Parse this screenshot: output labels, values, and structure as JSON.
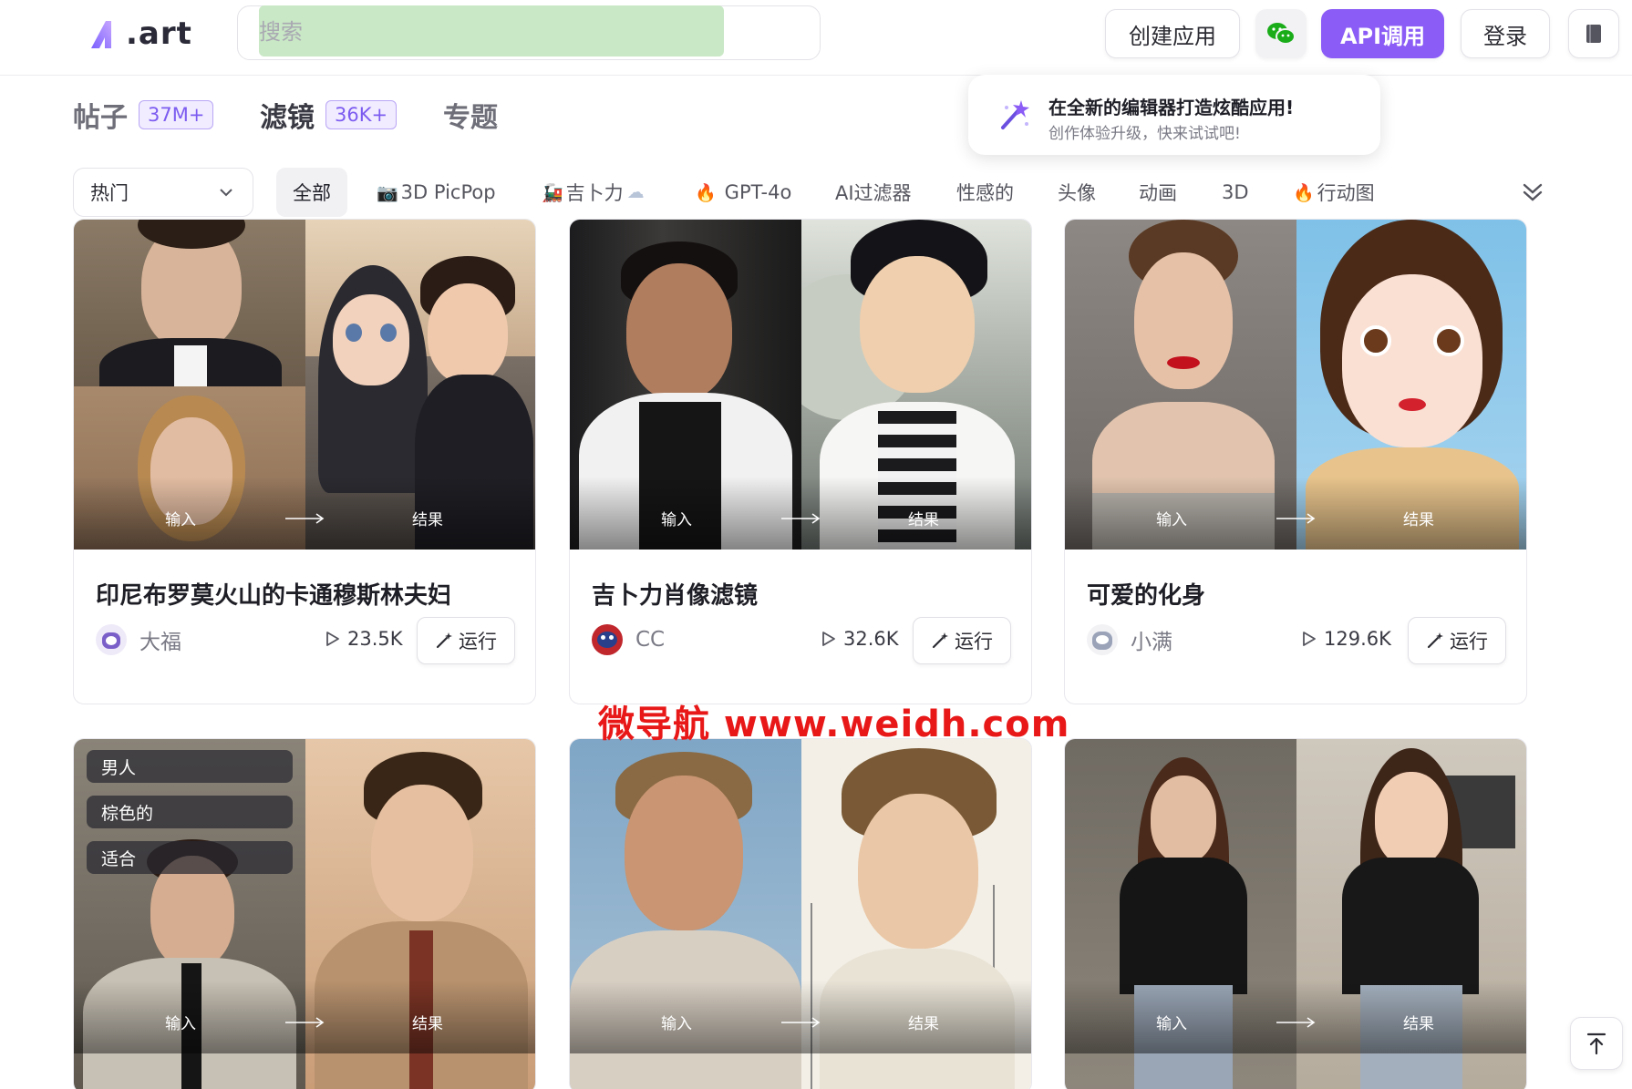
{
  "header": {
    "logo_text": ".art",
    "search": {
      "placeholder": "搜索",
      "value": ""
    },
    "buttons": {
      "create": "创建应用",
      "api": "API调用",
      "login": "登录"
    }
  },
  "promo": {
    "title": "在全新的编辑器打造炫酷应用!",
    "subtitle": "创作体验升级，快来试试吧!"
  },
  "content_tabs": [
    {
      "label": "帖子",
      "count": "37M+"
    },
    {
      "label": "滤镜",
      "count": "36K+"
    },
    {
      "label": "专题"
    }
  ],
  "filter_bar": {
    "sort_selected": "热门",
    "categories": [
      {
        "label": "全部",
        "active": true
      },
      {
        "label": "3D PicPop",
        "emoji": "📷"
      },
      {
        "label": "吉卜力",
        "emoji": "🚂",
        "suffix": "☁"
      },
      {
        "label": "GPT-4o",
        "emoji": "🔥"
      },
      {
        "label": "AI过滤器"
      },
      {
        "label": "性感的"
      },
      {
        "label": "头像"
      },
      {
        "label": "动画"
      },
      {
        "label": "3D"
      },
      {
        "label": "行动图",
        "emoji": "🔥"
      }
    ]
  },
  "cards": [
    {
      "title": "印尼布罗莫火山的卡通穆斯林夫妇",
      "author": "大福",
      "views": "23.5K",
      "run": "运行",
      "input_label": "输入",
      "output_label": "结果"
    },
    {
      "title": "吉卜力肖像滤镜",
      "author": "CC",
      "views": "32.6K",
      "run": "运行",
      "input_label": "输入",
      "output_label": "结果"
    },
    {
      "title": "可爱的化身",
      "author": "小满",
      "views": "129.6K",
      "run": "运行",
      "input_label": "输入",
      "output_label": "结果"
    },
    {
      "tags": [
        "男人",
        "棕色的",
        "适合"
      ],
      "input_label": "输入",
      "output_label": "结果"
    },
    {
      "input_label": "输入",
      "output_label": "结果"
    },
    {
      "input_label": "输入",
      "output_label": "结果"
    }
  ],
  "watermark": "微导航 www.weidh.com",
  "colors": {
    "accent": "#8b5cf6",
    "watermark": "#e81818",
    "search_highlight": "#c9e8c5"
  }
}
